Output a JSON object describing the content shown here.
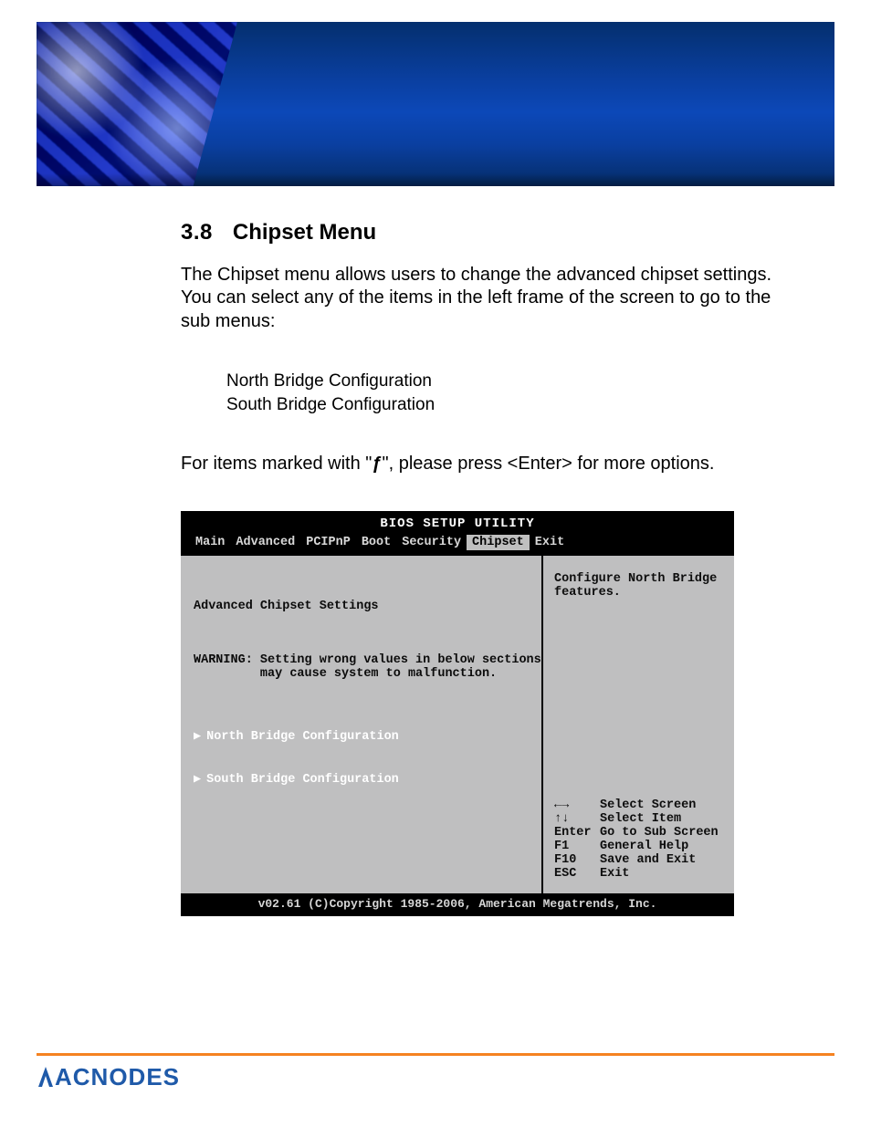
{
  "section": {
    "number": "3.8",
    "title": "Chipset Menu",
    "para": "The Chipset menu allows users to change the advanced chipset settings. You can select any of the items in the left frame of the screen to go to the sub menus:",
    "subitems": [
      "North Bridge Configuration",
      "South Bridge Configuration"
    ],
    "enter_prefix": "For items marked with \"",
    "enter_glyph": "ƒ",
    "enter_suffix": "\",  please press <Enter> for more options."
  },
  "bios": {
    "title": "BIOS SETUP UTILITY",
    "tabs": [
      "Main",
      "Advanced",
      "PCIPnP",
      "Boot",
      "Security",
      "Chipset",
      "Exit"
    ],
    "selected_tab_index": 5,
    "left": {
      "heading": "Advanced Chipset Settings",
      "warning": "WARNING: Setting wrong values in below sections\n         may cause system to malfunction.",
      "items": [
        "North Bridge Configuration",
        "South Bridge Configuration"
      ]
    },
    "right": {
      "desc": "Configure North Bridge features.",
      "help": [
        {
          "key": "←→",
          "label": "Select Screen"
        },
        {
          "key": "↑↓",
          "label": "Select Item"
        },
        {
          "key": "Enter",
          "label": "Go to Sub Screen"
        },
        {
          "key": "F1",
          "label": "General Help"
        },
        {
          "key": "F10",
          "label": "Save and Exit"
        },
        {
          "key": "ESC",
          "label": "Exit"
        }
      ]
    },
    "copyright": "v02.61 (C)Copyright 1985-2006, American Megatrends, Inc."
  },
  "footer": {
    "brand": "ACNODES"
  }
}
